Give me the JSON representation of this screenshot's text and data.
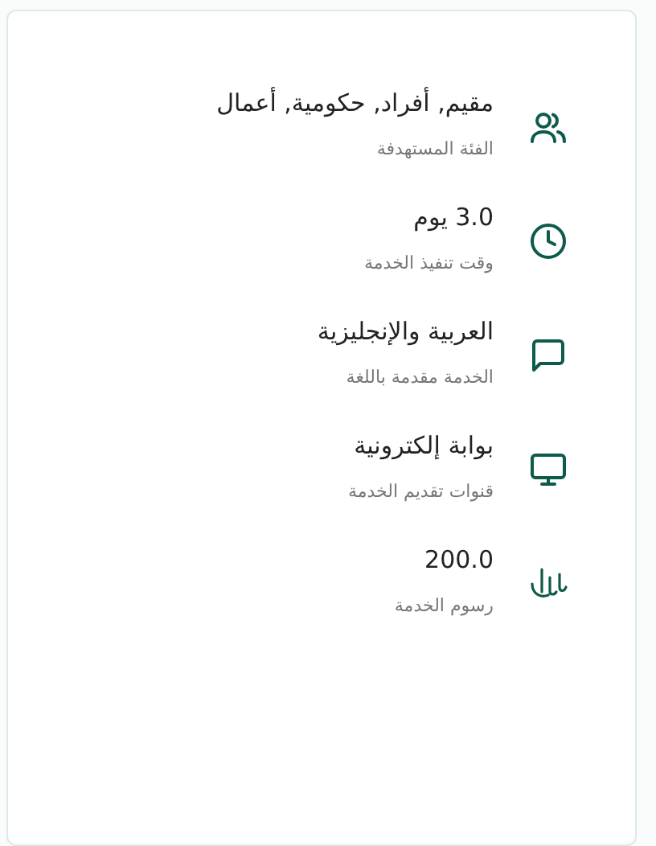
{
  "details": [
    {
      "kind": "people",
      "value": "مقيم, أفراد, حكومية, أعمال",
      "label": "الفئة المستهدفة"
    },
    {
      "kind": "clock",
      "value": "3.0 يوم",
      "label": "وقت تنفيذ الخدمة"
    },
    {
      "kind": "chat",
      "value": "العربية والإنجليزية",
      "label": "الخدمة مقدمة باللغة"
    },
    {
      "kind": "monitor",
      "value": "بوابة إلكترونية",
      "label": "قنوات تقديم الخدمة"
    },
    {
      "kind": "currency",
      "value": "200.0",
      "label": "رسوم الخدمة"
    }
  ]
}
